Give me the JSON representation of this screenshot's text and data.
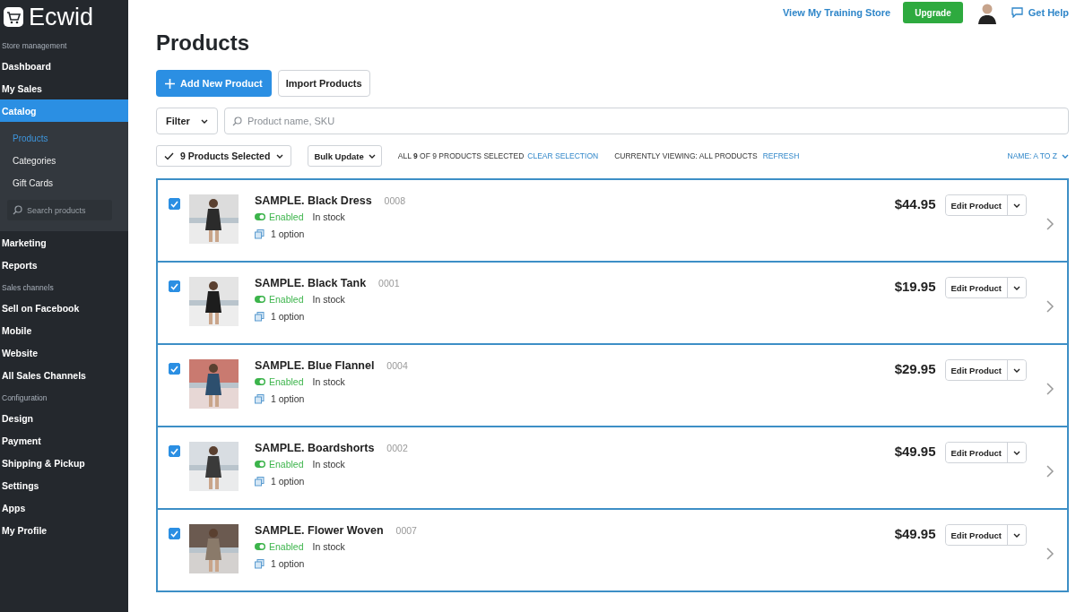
{
  "brand": {
    "name": "Ecwid"
  },
  "sidebar": {
    "groups": [
      {
        "header": "Store management",
        "items": [
          {
            "label": "Dashboard",
            "selected": false
          },
          {
            "label": "My Sales",
            "selected": false
          },
          {
            "label": "Catalog",
            "selected": true,
            "expanded": true,
            "children": [
              {
                "label": "Products",
                "selected": true
              },
              {
                "label": "Categories",
                "selected": false
              },
              {
                "label": "Gift Cards",
                "selected": false
              }
            ],
            "search_placeholder": "Search products"
          },
          {
            "label": "Marketing",
            "selected": false
          },
          {
            "label": "Reports",
            "selected": false
          }
        ]
      },
      {
        "header": "Sales channels",
        "items": [
          {
            "label": "Sell on Facebook",
            "selected": false
          },
          {
            "label": "Mobile",
            "selected": false
          },
          {
            "label": "Website",
            "selected": false
          },
          {
            "label": "All Sales Channels",
            "selected": false
          }
        ]
      },
      {
        "header": "Configuration",
        "items": [
          {
            "label": "Design",
            "selected": false
          },
          {
            "label": "Payment",
            "selected": false
          },
          {
            "label": "Shipping & Pickup",
            "selected": false
          },
          {
            "label": "Settings",
            "selected": false
          },
          {
            "label": "Apps",
            "selected": false
          },
          {
            "label": "My Profile",
            "selected": false
          }
        ]
      }
    ]
  },
  "topbar": {
    "store_link": "View My Training Store",
    "upgrade": "Upgrade",
    "help": "Get Help"
  },
  "title": "Products",
  "actions": {
    "primary": "Add New Product",
    "secondary": "Import Products"
  },
  "filter": {
    "label": "Filter",
    "placeholder": "Product name, SKU"
  },
  "selection": {
    "selected_label": "9 Products Selected",
    "bulk": "Bulk Update",
    "summary": "ALL **9** OF 9 PRODUCTS SELECTED",
    "clear": "CLEAR SELECTION",
    "viewing": "CURRENTLY VIEWING: ALL PRODUCTS",
    "refresh": "REFRESH",
    "sort": "NAME: A TO Z"
  },
  "products": [
    {
      "name": "SAMPLE. Black Dress",
      "sku": "0008",
      "selected": true,
      "enabled": true,
      "status": "Enabled",
      "stock": "In stock",
      "options": "1 option",
      "price": "$44.95",
      "edit": "Edit Product"
    },
    {
      "name": "SAMPLE. Black Tank",
      "sku": "0001",
      "selected": true,
      "enabled": true,
      "status": "Enabled",
      "stock": "In stock",
      "options": "1 option",
      "price": "$19.95",
      "edit": "Edit Product"
    },
    {
      "name": "SAMPLE. Blue Flannel",
      "sku": "0004",
      "selected": true,
      "enabled": true,
      "status": "Enabled",
      "stock": "In stock",
      "options": "1 option",
      "price": "$29.95",
      "edit": "Edit Product"
    },
    {
      "name": "SAMPLE. Boardshorts",
      "sku": "0002",
      "selected": true,
      "enabled": true,
      "status": "Enabled",
      "stock": "In stock",
      "options": "1 option",
      "price": "$49.95",
      "edit": "Edit Product"
    },
    {
      "name": "SAMPLE. Flower Woven",
      "sku": "0007",
      "selected": true,
      "enabled": true,
      "status": "Enabled",
      "stock": "In stock",
      "options": "1 option",
      "price": "$49.95",
      "edit": "Edit Product"
    }
  ]
}
